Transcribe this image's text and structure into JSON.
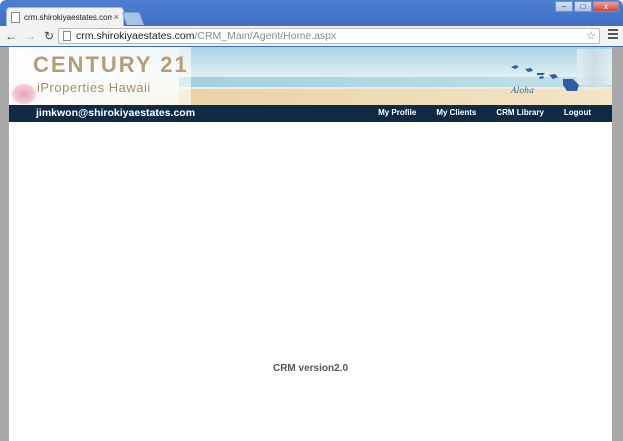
{
  "browser": {
    "tab_title": "crm.shirokiyaestates.com",
    "tab_close": "×",
    "url_host": "crm.shirokiyaestates.com",
    "url_path": "/CRM_Main/Agent/Home.aspx",
    "back_icon": "←",
    "forward_icon": "→",
    "reload_icon": "↻",
    "star_icon": "☆",
    "win_minimize": "–",
    "win_maximize": "□",
    "win_close": "x"
  },
  "banner": {
    "brand": "CENTURY 21",
    "subbrand": "iProperties Hawaii",
    "tagline": "Aloha"
  },
  "navbar": {
    "user_email": "jimkwon@shirokiyaestates.com",
    "links": [
      "My Profile",
      "My Clients",
      "CRM Library",
      "Logout"
    ]
  },
  "main": {
    "version_text": "CRM version2.0"
  },
  "colors": {
    "navbar_bg": "#0f2a45",
    "brand_gold": "#b59d74",
    "version_text": "#555555"
  }
}
